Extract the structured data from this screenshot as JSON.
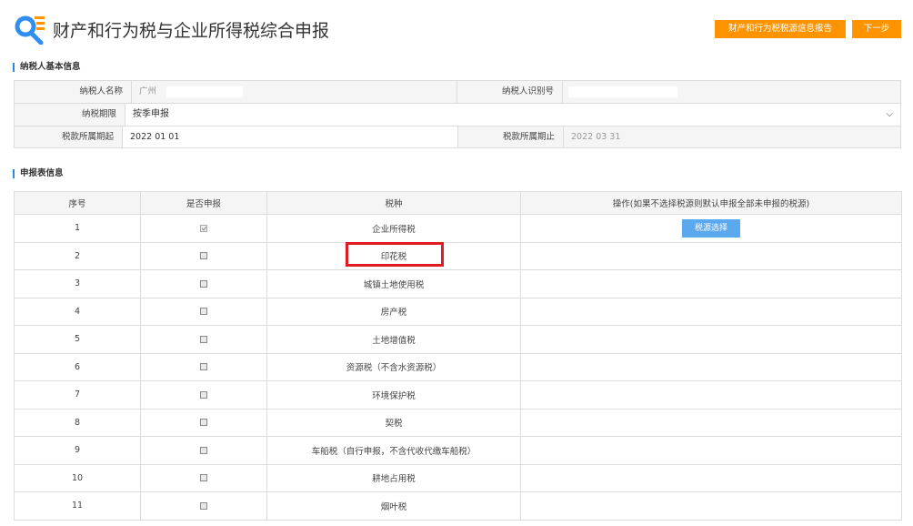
{
  "page": {
    "title": "财产和行为税与企业所得税综合申报",
    "buttons": {
      "report": "财产和行为税税源信息报告",
      "next": "下一步"
    }
  },
  "taxpayer_section": {
    "title": "纳税人基本信息",
    "name_label": "纳税人名称",
    "name_value": "广州",
    "id_label": "纳税人识别号",
    "id_value": "",
    "period_label": "纳税期限",
    "period_value": "按季申报",
    "start_label": "税款所属期起",
    "start_value": "2022 01 01",
    "end_label": "税款所属期止",
    "end_value": "2022 03 31"
  },
  "declaration_section": {
    "title": "申报表信息",
    "headers": [
      "序号",
      "是否申报",
      "税种",
      "操作(如果不选择税源则默认申报全部未申报的税源)"
    ],
    "select_source_label": "税源选择",
    "rows": [
      {
        "no": "1",
        "tax": "企业所得税",
        "checked": true
      },
      {
        "no": "2",
        "tax": "印花税",
        "checked": false
      },
      {
        "no": "3",
        "tax": "城镇土地使用税",
        "checked": false
      },
      {
        "no": "4",
        "tax": "房产税",
        "checked": false
      },
      {
        "no": "5",
        "tax": "土地增值税",
        "checked": false
      },
      {
        "no": "6",
        "tax": "资源税（不含水资源税）",
        "checked": false
      },
      {
        "no": "7",
        "tax": "环境保护税",
        "checked": false
      },
      {
        "no": "8",
        "tax": "契税",
        "checked": false
      },
      {
        "no": "9",
        "tax": "车船税（自行申报，不含代收代缴车船税）",
        "checked": false
      },
      {
        "no": "10",
        "tax": "耕地占用税",
        "checked": false
      },
      {
        "no": "11",
        "tax": "烟叶税",
        "checked": false
      }
    ]
  },
  "colors": {
    "accent_orange": "#ff9400",
    "accent_blue": "#5aa8ee",
    "highlight_red": "#e11b22"
  }
}
